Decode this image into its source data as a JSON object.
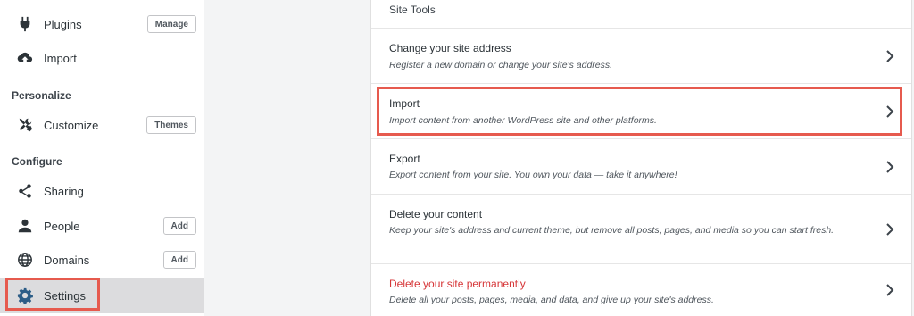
{
  "sidebar": {
    "plugins": {
      "label": "Plugins",
      "button": "Manage",
      "icon": "plug-icon"
    },
    "import": {
      "label": "Import",
      "icon": "cloud-upload-icon"
    },
    "personalize_title": "Personalize",
    "customize": {
      "label": "Customize",
      "button": "Themes",
      "icon": "tools-icon"
    },
    "configure_title": "Configure",
    "sharing": {
      "label": "Sharing",
      "icon": "share-icon"
    },
    "people": {
      "label": "People",
      "button": "Add",
      "icon": "person-icon"
    },
    "domains": {
      "label": "Domains",
      "button": "Add",
      "icon": "globe-icon"
    },
    "settings": {
      "label": "Settings",
      "icon": "gear-icon",
      "selected": true
    }
  },
  "main": {
    "header": "Site Tools",
    "rows": [
      {
        "title": "Change your site address",
        "desc": "Register a new domain or change your site's address."
      },
      {
        "title": "Import",
        "desc": "Import content from another WordPress site and other platforms."
      },
      {
        "title": "Export",
        "desc": "Export content from your site. You own your data — take it anywhere!"
      },
      {
        "title": "Delete your content",
        "desc": "Keep your site's address and current theme, but remove all posts, pages, and media so you can start fresh."
      },
      {
        "title": "Delete your site permanently",
        "desc": "Delete all your posts, pages, media, and data, and give up your site's address."
      }
    ]
  },
  "colors": {
    "highlight": "#e65a4e",
    "danger": "#d63638",
    "selected_bg": "#dcdcde"
  }
}
